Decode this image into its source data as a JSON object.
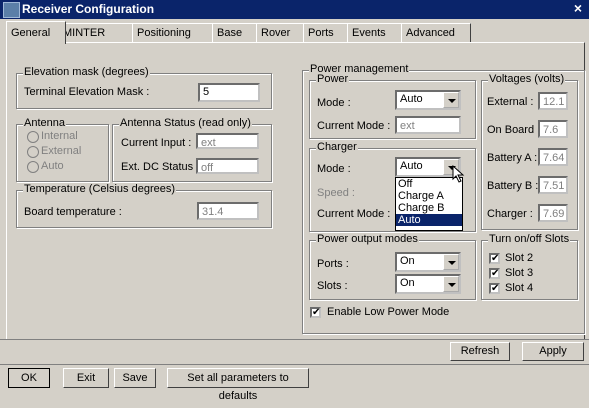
{
  "window": {
    "title": "Receiver Configuration",
    "close_symbol": "×"
  },
  "tabs": [
    "General",
    "MINTER",
    "Positioning",
    "Base",
    "Rover",
    "Ports",
    "Events",
    "Advanced"
  ],
  "elevation": {
    "group_title": "Elevation mask (degrees)",
    "label": "Terminal Elevation Mask :",
    "value": "5"
  },
  "antenna": {
    "group_title": "Antenna",
    "options": [
      "Internal",
      "External",
      "Auto"
    ]
  },
  "antenna_status": {
    "group_title": "Antenna Status (read only)",
    "current_input_label": "Current Input :",
    "current_input_value": "ext",
    "dc_status_label": "Ext. DC Status :",
    "dc_status_value": "off"
  },
  "temperature": {
    "group_title": "Temperature (Celsius degrees)",
    "label": "Board temperature :",
    "value": "31.4"
  },
  "power_management": {
    "group_title": "Power management"
  },
  "power": {
    "group_title": "Power",
    "mode_label": "Mode :",
    "mode_value": "Auto",
    "current_mode_label": "Current Mode :",
    "current_mode_value": "ext"
  },
  "charger": {
    "group_title": "Charger",
    "mode_label": "Mode :",
    "mode_value": "Auto",
    "speed_label": "Speed :",
    "current_mode_label": "Current Mode :",
    "dropdown_options": [
      "Off",
      "Charge A",
      "Charge B",
      "Auto"
    ]
  },
  "voltages": {
    "group_title": "Voltages (volts)",
    "items": [
      {
        "label": "External :",
        "value": "12.1"
      },
      {
        "label": "On Board :",
        "value": "7.6"
      },
      {
        "label": "Battery A :",
        "value": "7.64"
      },
      {
        "label": "Battery B :",
        "value": "7.51"
      },
      {
        "label": "Charger :",
        "value": "7.69"
      }
    ]
  },
  "power_output": {
    "group_title": "Power output modes",
    "ports_label": "Ports :",
    "ports_value": "On",
    "slots_label": "Slots :",
    "slots_value": "On"
  },
  "slots": {
    "group_title": "Turn on/off Slots",
    "items": [
      "Slot 2",
      "Slot 3",
      "Slot 4"
    ]
  },
  "low_power": {
    "label": "Enable Low Power Mode"
  },
  "buttons": {
    "refresh": "Refresh",
    "apply": "Apply",
    "ok": "OK",
    "exit": "Exit",
    "save": "Save",
    "defaults": "Set all parameters to defaults"
  }
}
